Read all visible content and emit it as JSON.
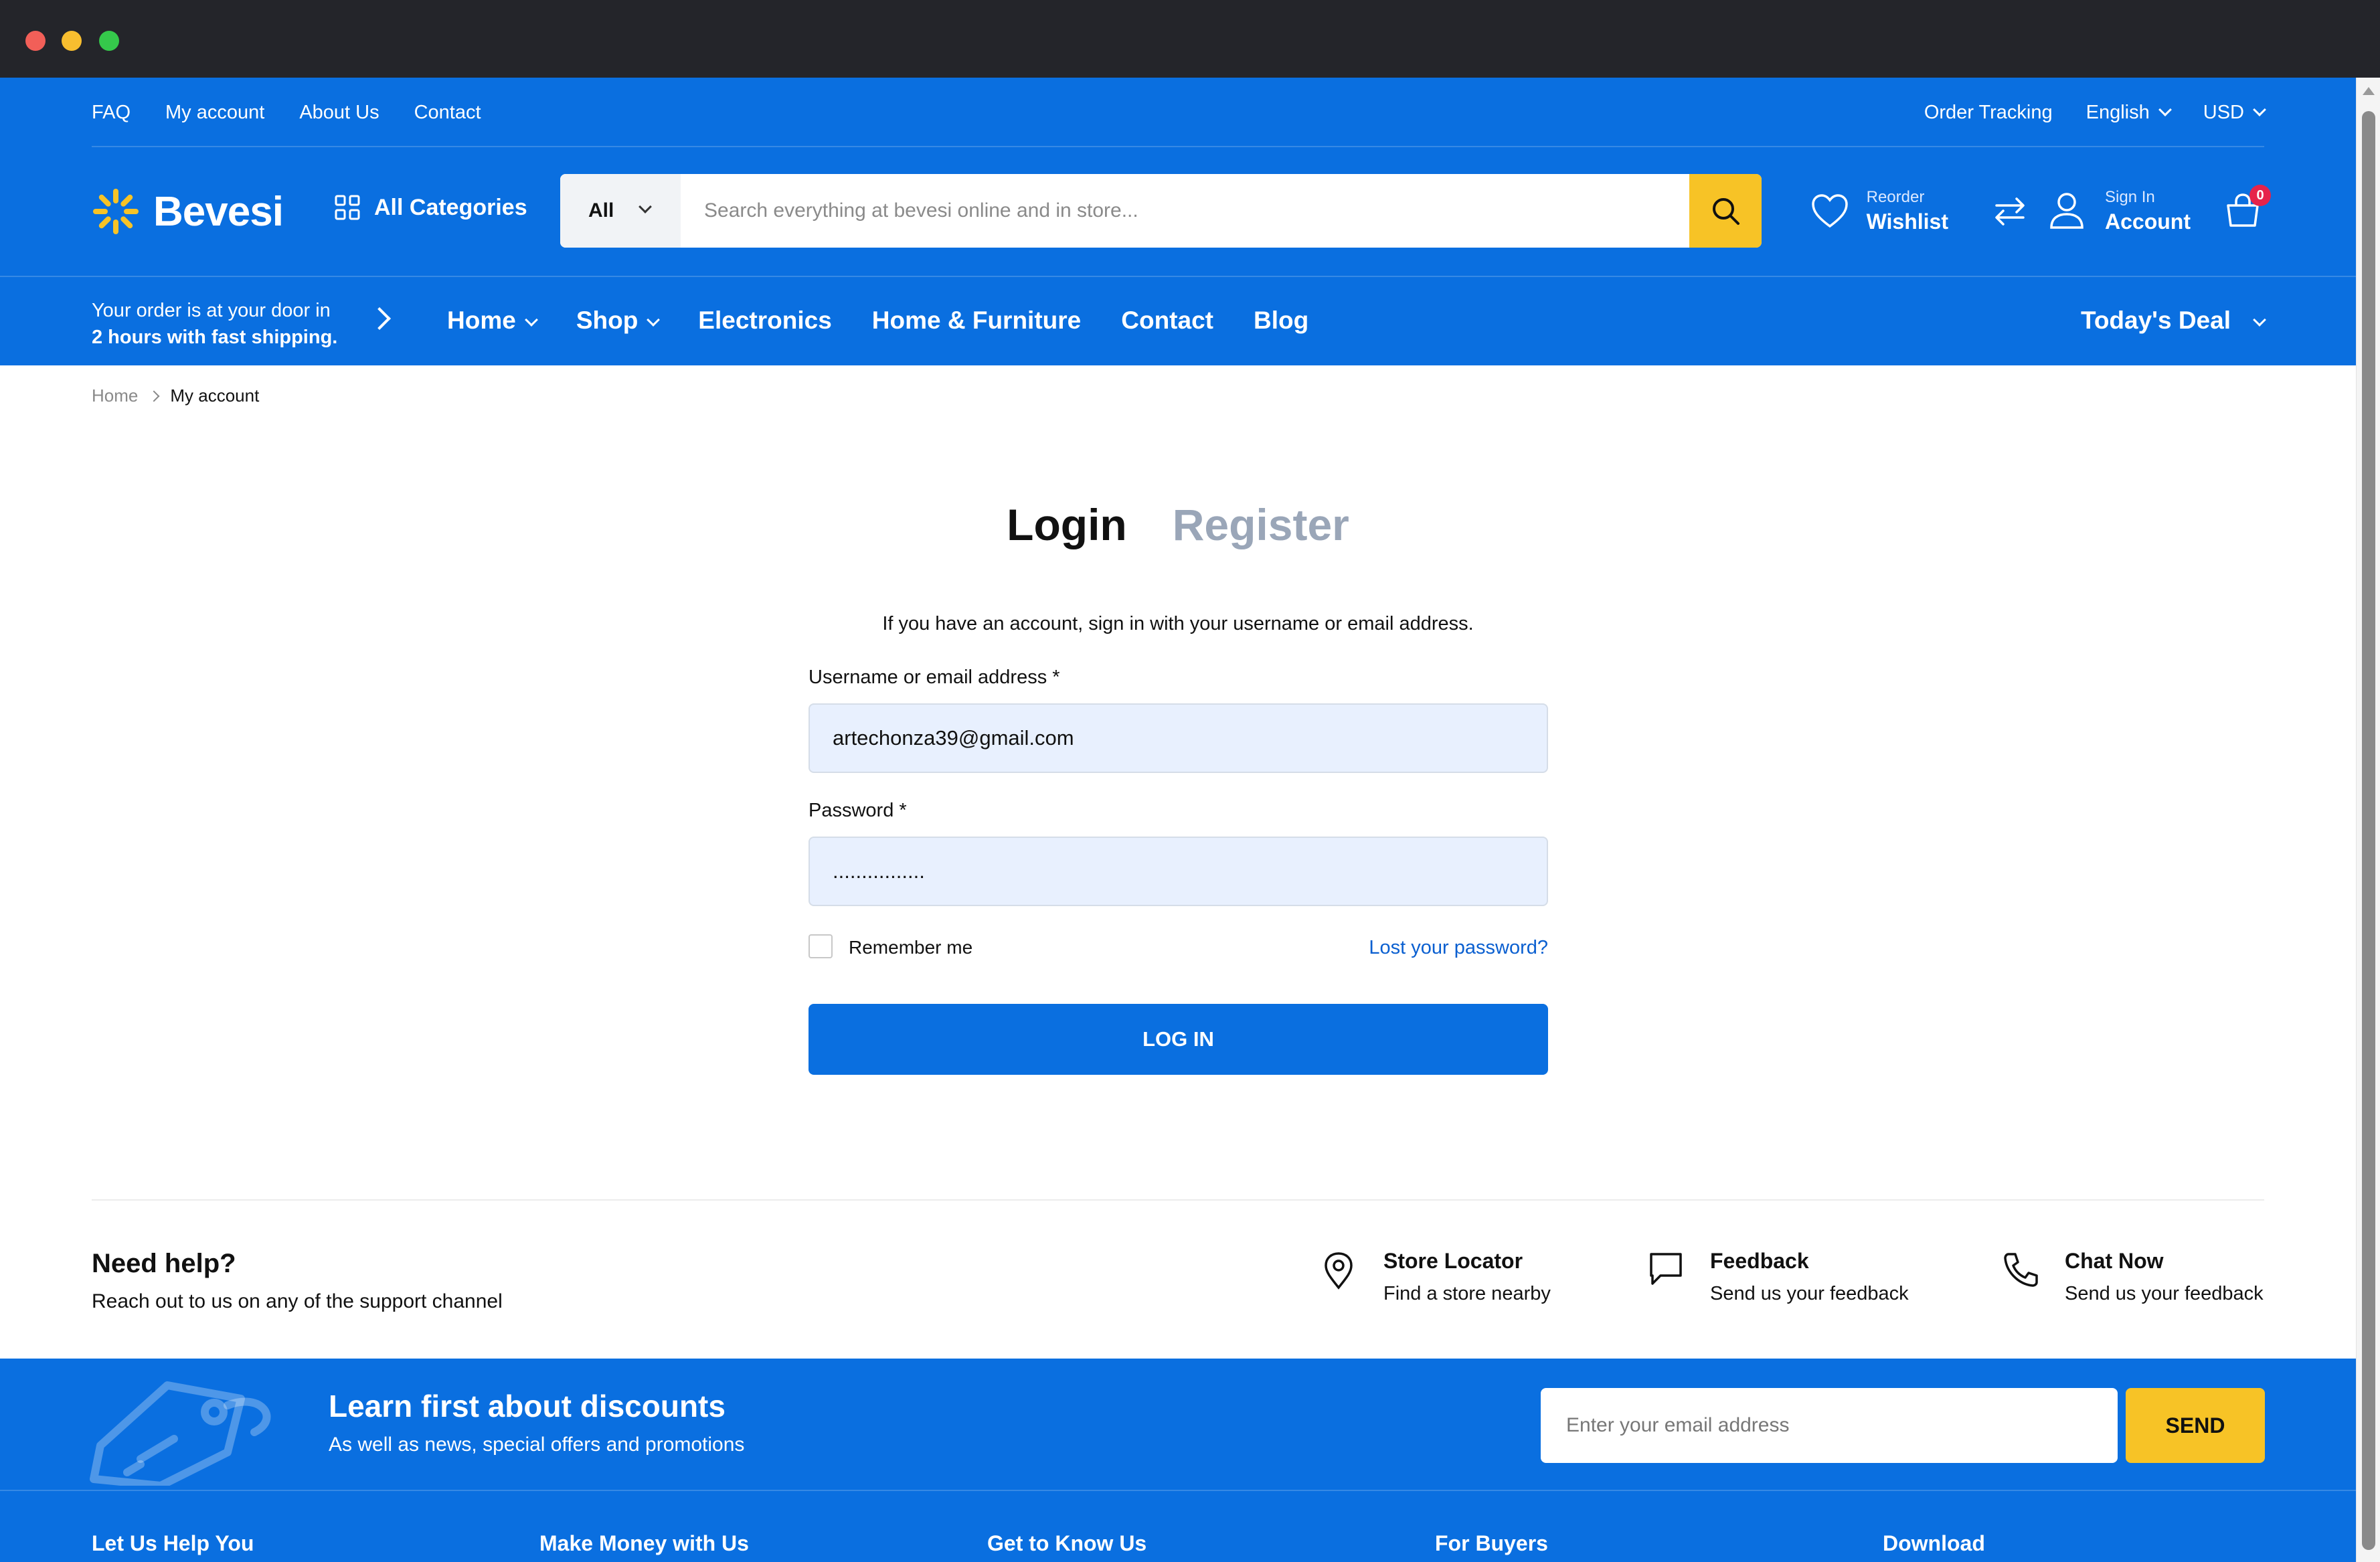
{
  "topbar": {
    "links": [
      "FAQ",
      "My account",
      "About Us",
      "Contact"
    ],
    "order_tracking": "Order Tracking",
    "language": "English",
    "currency": "USD"
  },
  "brand": {
    "name": "Bevesi",
    "logo_color": "#f7c326"
  },
  "categories_label": "All Categories",
  "search": {
    "category": "All",
    "placeholder": "Search everything at bevesi online and in store..."
  },
  "header_icons": {
    "wishlist_small": "Reorder",
    "wishlist_big": "Wishlist",
    "account_small": "Sign In",
    "account_big": "Account",
    "cart_count": "0",
    "icons": [
      "heart-icon",
      "compare-icon",
      "user-icon",
      "cart-icon"
    ]
  },
  "promo": {
    "line1": "Your order is at your door in",
    "line2": "2 hours with fast shipping."
  },
  "nav": {
    "home": "Home",
    "shop": "Shop",
    "electronics": "Electronics",
    "furniture": "Home & Furniture",
    "contact": "Contact",
    "blog": "Blog",
    "deal": "Today's Deal"
  },
  "breadcrumb": {
    "home": "Home",
    "current": "My account"
  },
  "auth": {
    "login_tab": "Login",
    "register_tab": "Register",
    "intro": "If you have an account, sign in with your username or email address.",
    "username_label": "Username or email address *",
    "username_value": "artechonza39@gmail.com",
    "password_label": "Password *",
    "password_value": "................",
    "remember_label": "Remember me",
    "lost_password": "Lost your password?",
    "login_button": "LOG IN"
  },
  "help": {
    "title": "Need help?",
    "subtitle": "Reach out to us on any of the support channel",
    "store_title": "Store Locator",
    "store_sub": "Find a store nearby",
    "feedback_title": "Feedback",
    "feedback_sub": "Send us your feedback",
    "chat_title": "Chat Now",
    "chat_sub": "Send us your feedback"
  },
  "newsletter": {
    "title": "Learn first about discounts",
    "subtitle": "As well as news, special offers and promotions",
    "placeholder": "Enter your email address",
    "send": "SEND"
  },
  "footer_columns": [
    "Let Us Help You",
    "Make Money with Us",
    "Get to Know Us",
    "For Buyers",
    "Download"
  ],
  "colors": {
    "primary": "#0a6fe0",
    "accent": "#f7c326",
    "badge": "#e6234b"
  }
}
